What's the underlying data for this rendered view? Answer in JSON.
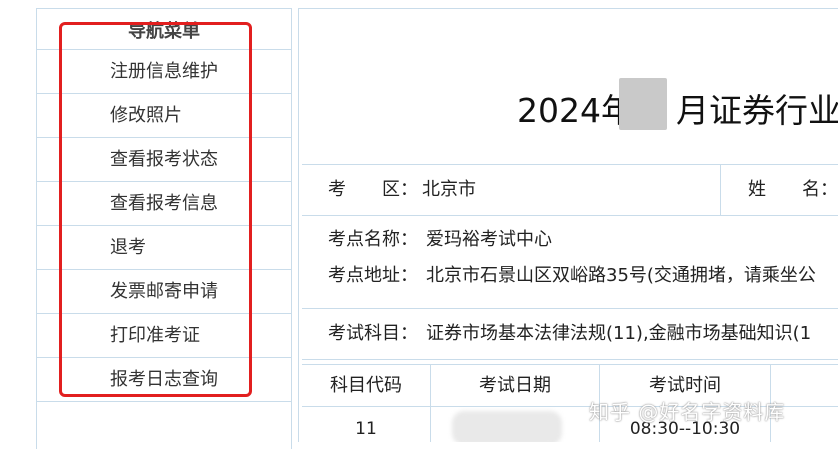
{
  "sidebar": {
    "title": "导航菜单",
    "items": [
      {
        "label": "注册信息维护"
      },
      {
        "label": "修改照片"
      },
      {
        "label": "查看报考状态"
      },
      {
        "label": "查看报考信息"
      },
      {
        "label": "退考"
      },
      {
        "label": "发票邮寄申请"
      },
      {
        "label": "打印准考证"
      },
      {
        "label": "报考日志查询"
      }
    ]
  },
  "main": {
    "title_prefix": "2024年",
    "title_suffix": "月证券行业专",
    "info": {
      "area_label": "考　　区：",
      "area_value": "北京市",
      "name_label": "姓　　名：",
      "site_name_label": "考点名称：",
      "site_name_value": "爱玛裕考试中心",
      "site_addr_label": "考点地址：",
      "site_addr_value": "北京市石景山区双峪路35号(交通拥堵，请乘坐公",
      "subjects_label": "考试科目：",
      "subjects_value": "证券市场基本法律法规(11),金融市场基础知识(1"
    },
    "table": {
      "headers": [
        "科目代码",
        "考试日期",
        "考试时间"
      ],
      "rows": [
        {
          "code": "11",
          "date": "",
          "time": "08:30--10:30"
        }
      ]
    }
  },
  "watermark": "知乎 @好名字资料库",
  "colors": {
    "highlight": "#e21f1f",
    "border": "#c9dcea"
  }
}
